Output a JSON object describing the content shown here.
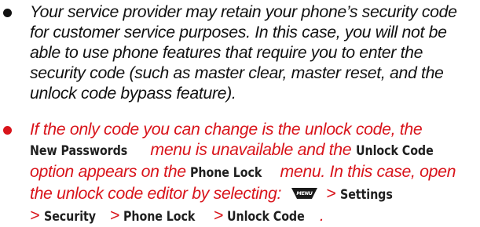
{
  "bullets": [
    {
      "color": "#111111",
      "lines": [
        "Your service provider may retain your phone’s security code",
        "for customer service purposes. In this case, you will not be",
        "able to use phone features that require you to enter the",
        "security code (such as master clear, master reset, and the",
        "unlock code bypass feature)."
      ]
    },
    {
      "color": "#d9141b",
      "line1": "If the only code you can change is the unlock code, the",
      "line2_term": "New Passwords",
      "line2_text": " menu is unavailable and the ",
      "line2_term2": "Unlock Code",
      "line3_text": "option appears on the ",
      "line3_term": "Phone Lock",
      "line3_text2": " menu. In this case, open",
      "line4_text": "the unlock code editor by selecting:",
      "menu_key_label": "MENU",
      "line4_sep": ">",
      "line4_term": "Settings",
      "line5_sep1": "> ",
      "line5_term1": "Security",
      "line5_sep2": " > ",
      "line5_term2": "Phone Lock",
      "line5_sep3": " > ",
      "line5_term3": "Unlock Code",
      "line5_end": "."
    }
  ],
  "colors": {
    "body_text": "#111111",
    "highlight_text": "#d9141b",
    "ui_term": "#1f1f1f",
    "menu_key_fill": "#1a1a1a"
  }
}
